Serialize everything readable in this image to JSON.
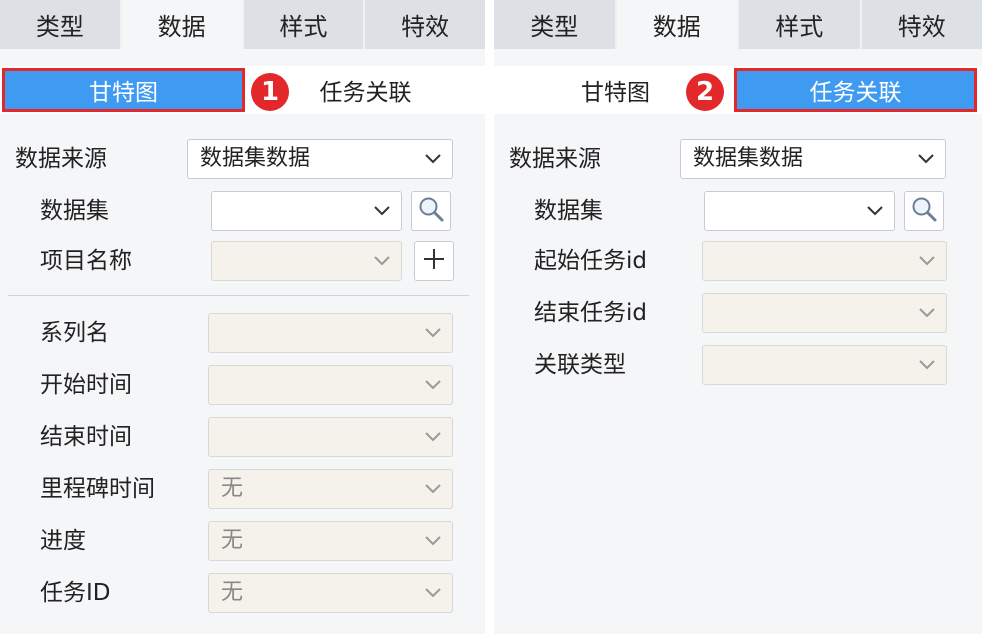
{
  "tabs": [
    "类型",
    "数据",
    "样式",
    "特效"
  ],
  "subtabs": {
    "gantt": "甘特图",
    "task_link": "任务关联"
  },
  "badges": {
    "left": "1",
    "right": "2"
  },
  "left": {
    "data_source_label": "数据来源",
    "data_source_value": "数据集数据",
    "dataset_label": "数据集",
    "dataset_value": "",
    "project_name_label": "项目名称",
    "series_label": "系列名",
    "start_time_label": "开始时间",
    "end_time_label": "结束时间",
    "milestone_label": "里程碑时间",
    "milestone_value": "无",
    "progress_label": "进度",
    "progress_value": "无",
    "task_id_label": "任务ID",
    "task_id_value": "无"
  },
  "right": {
    "data_source_label": "数据来源",
    "data_source_value": "数据集数据",
    "dataset_label": "数据集",
    "dataset_value": "",
    "start_task_label": "起始任务id",
    "end_task_label": "结束任务id",
    "link_type_label": "关联类型"
  }
}
